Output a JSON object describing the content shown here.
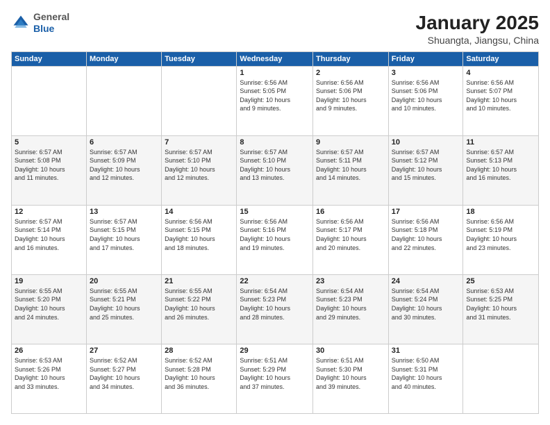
{
  "header": {
    "logo": {
      "general": "General",
      "blue": "Blue"
    },
    "title": "January 2025",
    "subtitle": "Shuangta, Jiangsu, China"
  },
  "weekdays": [
    "Sunday",
    "Monday",
    "Tuesday",
    "Wednesday",
    "Thursday",
    "Friday",
    "Saturday"
  ],
  "weeks": [
    [
      {
        "day": "",
        "info": ""
      },
      {
        "day": "",
        "info": ""
      },
      {
        "day": "",
        "info": ""
      },
      {
        "day": "1",
        "info": "Sunrise: 6:56 AM\nSunset: 5:05 PM\nDaylight: 10 hours\nand 9 minutes."
      },
      {
        "day": "2",
        "info": "Sunrise: 6:56 AM\nSunset: 5:06 PM\nDaylight: 10 hours\nand 9 minutes."
      },
      {
        "day": "3",
        "info": "Sunrise: 6:56 AM\nSunset: 5:06 PM\nDaylight: 10 hours\nand 10 minutes."
      },
      {
        "day": "4",
        "info": "Sunrise: 6:56 AM\nSunset: 5:07 PM\nDaylight: 10 hours\nand 10 minutes."
      }
    ],
    [
      {
        "day": "5",
        "info": "Sunrise: 6:57 AM\nSunset: 5:08 PM\nDaylight: 10 hours\nand 11 minutes."
      },
      {
        "day": "6",
        "info": "Sunrise: 6:57 AM\nSunset: 5:09 PM\nDaylight: 10 hours\nand 12 minutes."
      },
      {
        "day": "7",
        "info": "Sunrise: 6:57 AM\nSunset: 5:10 PM\nDaylight: 10 hours\nand 12 minutes."
      },
      {
        "day": "8",
        "info": "Sunrise: 6:57 AM\nSunset: 5:10 PM\nDaylight: 10 hours\nand 13 minutes."
      },
      {
        "day": "9",
        "info": "Sunrise: 6:57 AM\nSunset: 5:11 PM\nDaylight: 10 hours\nand 14 minutes."
      },
      {
        "day": "10",
        "info": "Sunrise: 6:57 AM\nSunset: 5:12 PM\nDaylight: 10 hours\nand 15 minutes."
      },
      {
        "day": "11",
        "info": "Sunrise: 6:57 AM\nSunset: 5:13 PM\nDaylight: 10 hours\nand 16 minutes."
      }
    ],
    [
      {
        "day": "12",
        "info": "Sunrise: 6:57 AM\nSunset: 5:14 PM\nDaylight: 10 hours\nand 16 minutes."
      },
      {
        "day": "13",
        "info": "Sunrise: 6:57 AM\nSunset: 5:15 PM\nDaylight: 10 hours\nand 17 minutes."
      },
      {
        "day": "14",
        "info": "Sunrise: 6:56 AM\nSunset: 5:15 PM\nDaylight: 10 hours\nand 18 minutes."
      },
      {
        "day": "15",
        "info": "Sunrise: 6:56 AM\nSunset: 5:16 PM\nDaylight: 10 hours\nand 19 minutes."
      },
      {
        "day": "16",
        "info": "Sunrise: 6:56 AM\nSunset: 5:17 PM\nDaylight: 10 hours\nand 20 minutes."
      },
      {
        "day": "17",
        "info": "Sunrise: 6:56 AM\nSunset: 5:18 PM\nDaylight: 10 hours\nand 22 minutes."
      },
      {
        "day": "18",
        "info": "Sunrise: 6:56 AM\nSunset: 5:19 PM\nDaylight: 10 hours\nand 23 minutes."
      }
    ],
    [
      {
        "day": "19",
        "info": "Sunrise: 6:55 AM\nSunset: 5:20 PM\nDaylight: 10 hours\nand 24 minutes."
      },
      {
        "day": "20",
        "info": "Sunrise: 6:55 AM\nSunset: 5:21 PM\nDaylight: 10 hours\nand 25 minutes."
      },
      {
        "day": "21",
        "info": "Sunrise: 6:55 AM\nSunset: 5:22 PM\nDaylight: 10 hours\nand 26 minutes."
      },
      {
        "day": "22",
        "info": "Sunrise: 6:54 AM\nSunset: 5:23 PM\nDaylight: 10 hours\nand 28 minutes."
      },
      {
        "day": "23",
        "info": "Sunrise: 6:54 AM\nSunset: 5:23 PM\nDaylight: 10 hours\nand 29 minutes."
      },
      {
        "day": "24",
        "info": "Sunrise: 6:54 AM\nSunset: 5:24 PM\nDaylight: 10 hours\nand 30 minutes."
      },
      {
        "day": "25",
        "info": "Sunrise: 6:53 AM\nSunset: 5:25 PM\nDaylight: 10 hours\nand 31 minutes."
      }
    ],
    [
      {
        "day": "26",
        "info": "Sunrise: 6:53 AM\nSunset: 5:26 PM\nDaylight: 10 hours\nand 33 minutes."
      },
      {
        "day": "27",
        "info": "Sunrise: 6:52 AM\nSunset: 5:27 PM\nDaylight: 10 hours\nand 34 minutes."
      },
      {
        "day": "28",
        "info": "Sunrise: 6:52 AM\nSunset: 5:28 PM\nDaylight: 10 hours\nand 36 minutes."
      },
      {
        "day": "29",
        "info": "Sunrise: 6:51 AM\nSunset: 5:29 PM\nDaylight: 10 hours\nand 37 minutes."
      },
      {
        "day": "30",
        "info": "Sunrise: 6:51 AM\nSunset: 5:30 PM\nDaylight: 10 hours\nand 39 minutes."
      },
      {
        "day": "31",
        "info": "Sunrise: 6:50 AM\nSunset: 5:31 PM\nDaylight: 10 hours\nand 40 minutes."
      },
      {
        "day": "",
        "info": ""
      }
    ]
  ]
}
